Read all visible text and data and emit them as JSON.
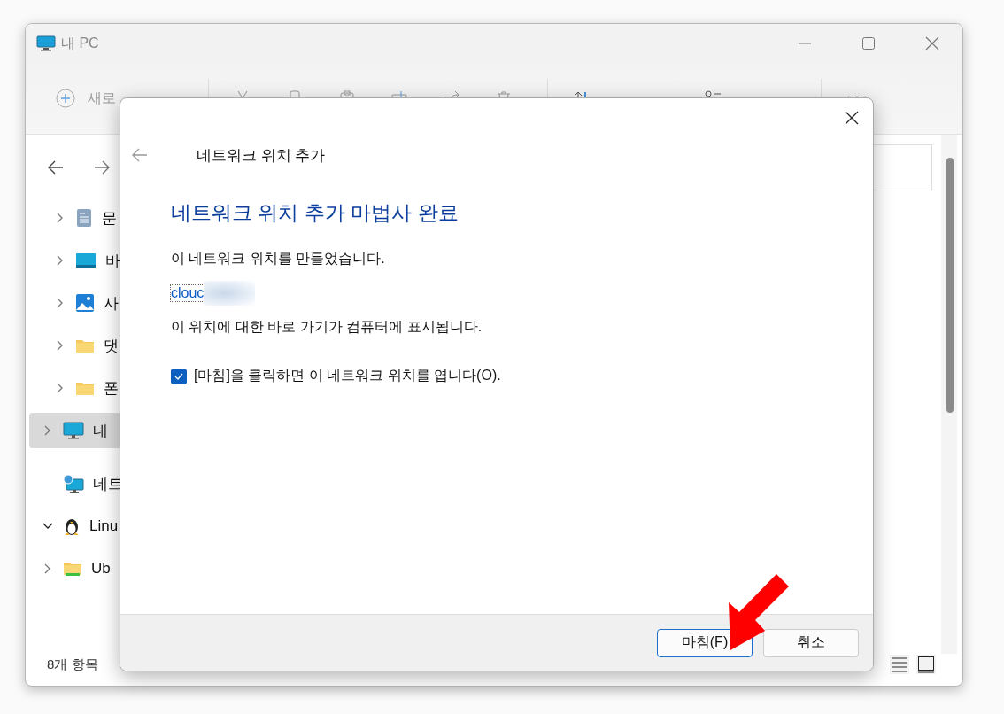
{
  "window": {
    "title": "내 PC"
  },
  "toolbar": {
    "new_label": "새로"
  },
  "sidebar": {
    "items": [
      {
        "label": "문",
        "kind": "document",
        "expandable": true,
        "expanded": false,
        "selected": false
      },
      {
        "label": "바",
        "kind": "desktop",
        "expandable": true,
        "expanded": false,
        "selected": false
      },
      {
        "label": "사",
        "kind": "pictures",
        "expandable": true,
        "expanded": false,
        "selected": false
      },
      {
        "label": "댓",
        "kind": "folder",
        "expandable": true,
        "expanded": false,
        "selected": false
      },
      {
        "label": "폰",
        "kind": "folder",
        "expandable": true,
        "expanded": false,
        "selected": false
      },
      {
        "label": "내",
        "kind": "pc",
        "expandable": true,
        "expanded": false,
        "selected": true
      },
      {
        "label": "네트",
        "kind": "network",
        "expandable": false,
        "selected": false
      },
      {
        "label": "Linu",
        "kind": "linux",
        "expandable": true,
        "expanded": true,
        "selected": false
      },
      {
        "label": "Ub",
        "kind": "drive",
        "expandable": true,
        "expanded": false,
        "selected": false
      }
    ]
  },
  "status_bar": {
    "text": "8개 항목"
  },
  "dialog": {
    "title": "네트워크 위치 추가",
    "heading": "네트워크 위치 추가 마법사 완료",
    "message": "이 네트워크 위치를 만들었습니다.",
    "link": "clouc",
    "note": "이 위치에 대한 바로 가기가 컴퓨터에 표시됩니다.",
    "checkbox": {
      "label": "[마침]을 클릭하면 이 네트워크 위치를 엽니다(O).",
      "checked": true
    },
    "buttons": [
      {
        "label": "마침(F)",
        "default": true
      },
      {
        "label": "취소",
        "default": false
      }
    ]
  }
}
